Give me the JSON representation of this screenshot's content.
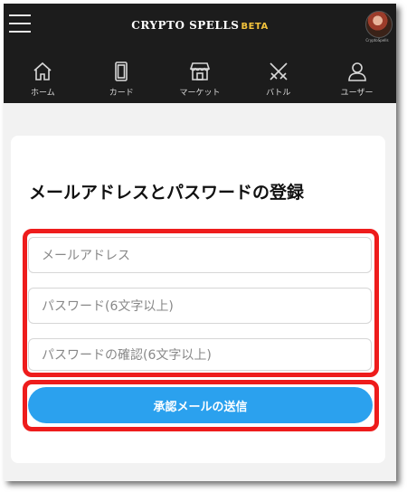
{
  "header": {
    "logo_text": "CRYPTO SPELLS",
    "logo_badge": "BETA",
    "avatar_caption": "CryptoSpells"
  },
  "nav": {
    "items": [
      {
        "label": "ホーム",
        "icon": "home-icon"
      },
      {
        "label": "カード",
        "icon": "card-icon"
      },
      {
        "label": "マーケット",
        "icon": "market-icon"
      },
      {
        "label": "バトル",
        "icon": "battle-icon"
      },
      {
        "label": "ユーザー",
        "icon": "user-icon"
      }
    ]
  },
  "form": {
    "title": "メールアドレスとパスワードの登録",
    "email_placeholder": "メールアドレス",
    "password_placeholder": "パスワード(6文字以上)",
    "password_confirm_placeholder": "パスワードの確認(6文字以上)",
    "submit_label": "承認メールの送信"
  },
  "colors": {
    "header_bg": "#1c1c1c",
    "highlight": "#ee1c1c",
    "button": "#2ba1ee",
    "badge": "#f2c23c"
  }
}
